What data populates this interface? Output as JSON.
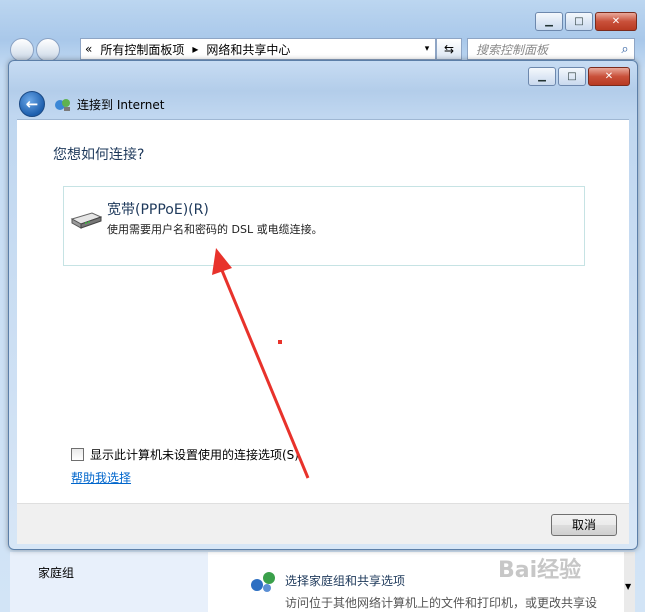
{
  "outer": {
    "address": {
      "prefix": "«",
      "crumb1": "所有控制面板项",
      "separator": "▸",
      "crumb2": "网络和共享中心",
      "dropdown_arrow": "▾"
    },
    "refresh_icon": "refresh-icon",
    "search": {
      "placeholder": "搜索控制面板"
    },
    "caption": {
      "minimize": "▁",
      "maximize": "□",
      "close": "✕"
    }
  },
  "dialog": {
    "title": "连接到 Internet",
    "caption": {
      "minimize": "▁",
      "maximize": "□",
      "close": "✕"
    },
    "question": "您想如何连接?",
    "option": {
      "title": "宽带(PPPoE)(R)",
      "description": "使用需要用户名和密码的 DSL 或电缆连接。"
    },
    "checkbox_label": "显示此计算机未设置使用的连接选项(S)",
    "help_link": "帮助我选择",
    "cancel_label": "取消"
  },
  "background": {
    "sidebar_item": "家庭组",
    "homegroup_link": "选择家庭组和共享选项",
    "cut_text": "访问位于其他网络计算机上的文件和打印机，或更改共享设"
  },
  "colors": {
    "accent": "#1e395b",
    "link": "#0066cc",
    "annotation_arrow": "#e8322b"
  }
}
